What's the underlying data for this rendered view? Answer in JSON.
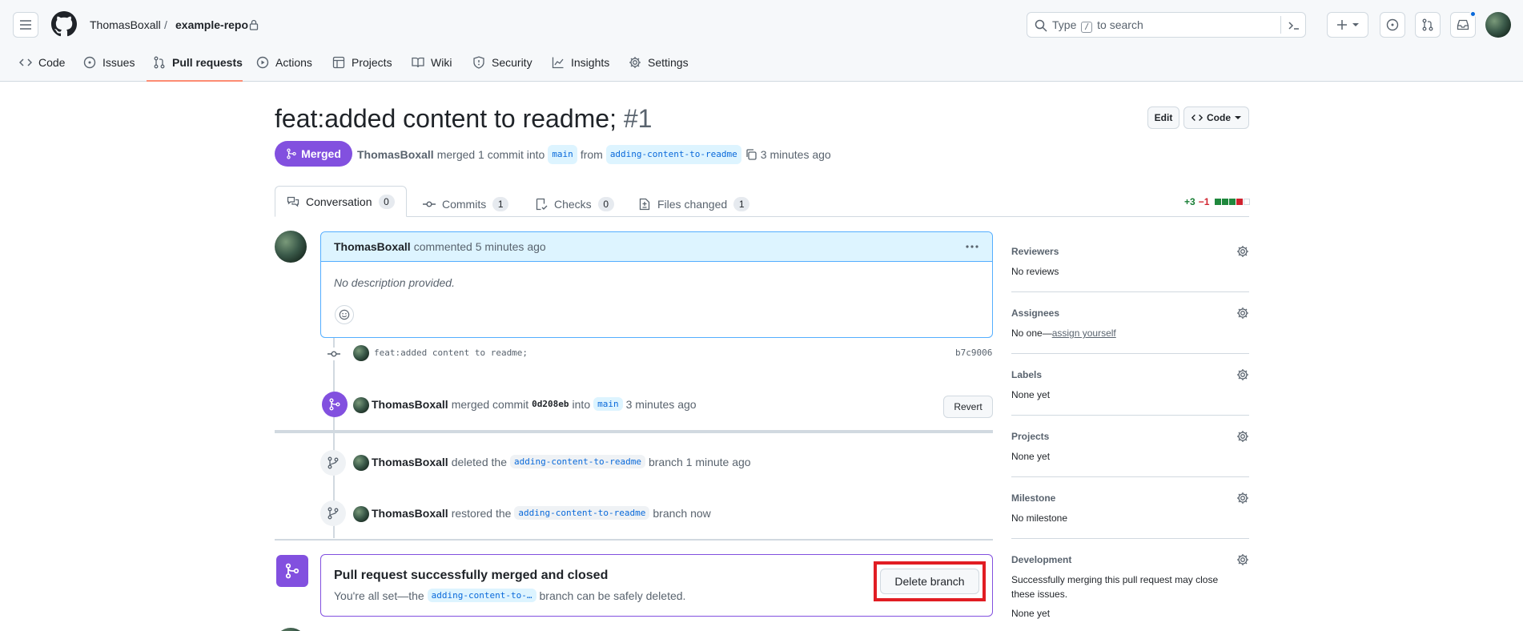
{
  "header": {
    "owner": "ThomasBoxall",
    "separator": "/",
    "repo": "example-repo",
    "search_pre": "Type",
    "search_key": "/",
    "search_post": "to search",
    "notification_dot_color": "#0969da"
  },
  "nav": {
    "tabs": [
      {
        "label": "Code",
        "icon": "code-icon"
      },
      {
        "label": "Issues",
        "icon": "issue-icon"
      },
      {
        "label": "Pull requests",
        "icon": "pull-request-icon"
      },
      {
        "label": "Actions",
        "icon": "play-icon"
      },
      {
        "label": "Projects",
        "icon": "table-icon"
      },
      {
        "label": "Wiki",
        "icon": "book-icon"
      },
      {
        "label": "Security",
        "icon": "shield-icon"
      },
      {
        "label": "Insights",
        "icon": "graph-icon"
      },
      {
        "label": "Settings",
        "icon": "gear-icon"
      }
    ],
    "active": "Pull requests"
  },
  "pr": {
    "title": "feat:added content to readme;",
    "number": "#1",
    "state": "Merged",
    "author": "ThomasBoxall",
    "merged_text": "merged 1 commit into",
    "base_branch": "main",
    "from_text": "from",
    "head_branch": "adding-content-to-readme",
    "time": "3 minutes ago",
    "edit_label": "Edit",
    "code_label": "Code",
    "state_color": "#8250df"
  },
  "tabs": [
    {
      "label": "Conversation",
      "count": "0"
    },
    {
      "label": "Commits",
      "count": "1"
    },
    {
      "label": "Checks",
      "count": "0"
    },
    {
      "label": "Files changed",
      "count": "1"
    }
  ],
  "diffstat": {
    "additions": "+3",
    "deletions": "−1"
  },
  "comment": {
    "author": "ThomasBoxall",
    "action": "commented 5 minutes ago",
    "body": "No description provided."
  },
  "timeline": {
    "commit": {
      "message": "feat:added content to readme;",
      "sha": "b7c9006"
    },
    "merge": {
      "author": "ThomasBoxall",
      "text1": "merged commit",
      "sha": "0d208eb",
      "text2": "into",
      "branch": "main",
      "time": "3 minutes ago",
      "revert_label": "Revert"
    },
    "deleted": {
      "author": "ThomasBoxall",
      "text1": "deleted the",
      "branch": "adding-content-to-readme",
      "text2": "branch 1 minute ago"
    },
    "restored": {
      "author": "ThomasBoxall",
      "text1": "restored the",
      "branch": "adding-content-to-readme",
      "text2": "branch now"
    }
  },
  "merge_box": {
    "title": "Pull request successfully merged and closed",
    "text1": "You're all set—the",
    "branch": "adding-content-to-…",
    "text2": "branch can be safely deleted.",
    "delete_label": "Delete branch"
  },
  "sidebar": {
    "reviewers": {
      "title": "Reviewers",
      "value": "No reviews"
    },
    "assignees": {
      "title": "Assignees",
      "value": "No one—",
      "link": "assign yourself"
    },
    "labels": {
      "title": "Labels",
      "value": "None yet"
    },
    "projects": {
      "title": "Projects",
      "value": "None yet"
    },
    "milestone": {
      "title": "Milestone",
      "value": "No milestone"
    },
    "development": {
      "title": "Development",
      "value": "Successfully merging this pull request may close these issues.",
      "value2": "None yet"
    }
  }
}
